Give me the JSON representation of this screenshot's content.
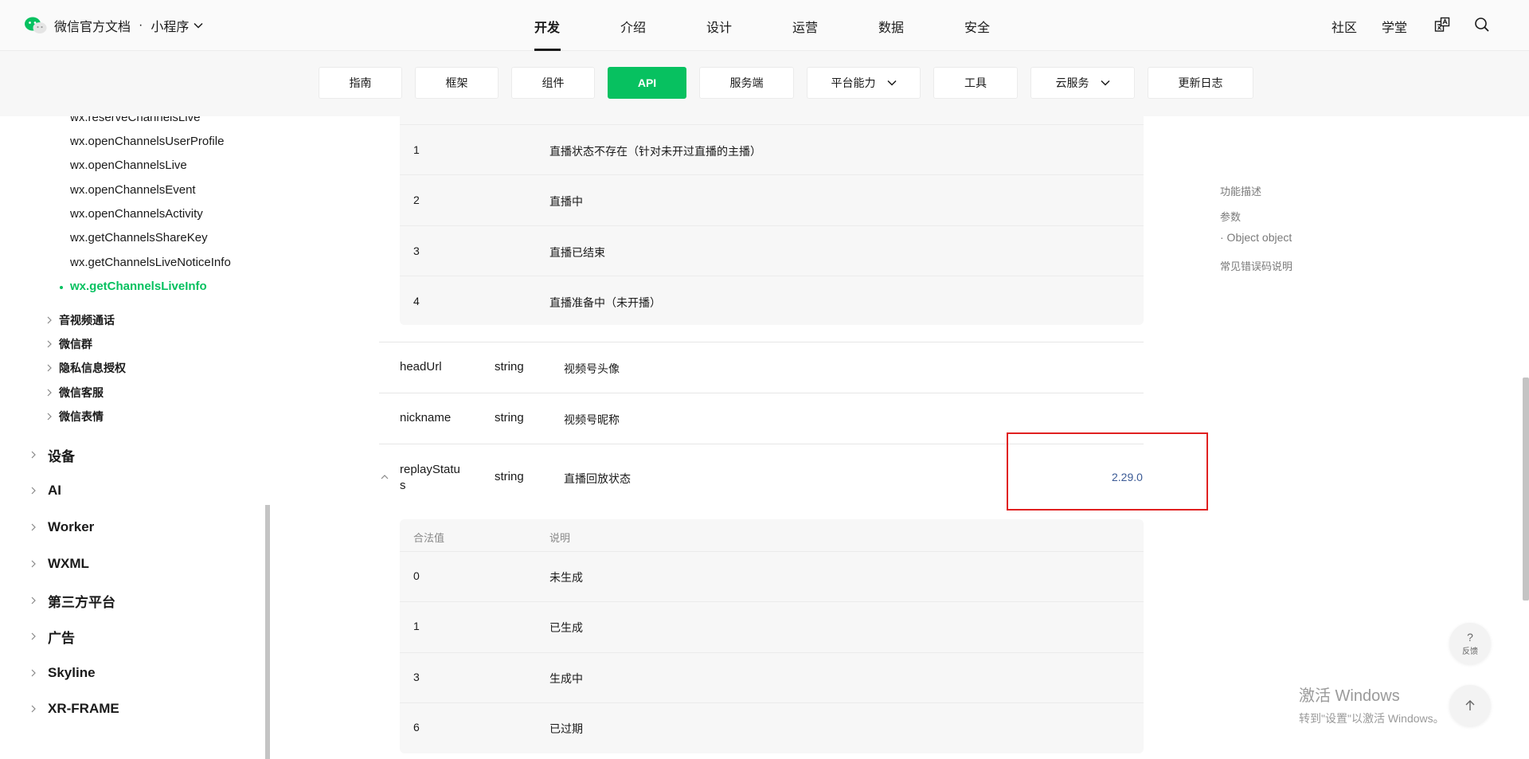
{
  "header": {
    "site_name": "微信官方文档",
    "separator": "·",
    "product": "小程序",
    "nav": [
      "开发",
      "介绍",
      "设计",
      "运营",
      "数据",
      "安全"
    ],
    "active_nav": "开发",
    "right_links": [
      "社区",
      "学堂"
    ],
    "icons": [
      "translate-icon",
      "search-icon"
    ]
  },
  "subnav": {
    "items": [
      {
        "label": "指南"
      },
      {
        "label": "框架"
      },
      {
        "label": "组件"
      },
      {
        "label": "API"
      },
      {
        "label": "服务端"
      },
      {
        "label": "平台能力"
      },
      {
        "label": "工具"
      },
      {
        "label": "云服务"
      },
      {
        "label": "更新日志"
      }
    ],
    "active": "API",
    "accent": "#07c160"
  },
  "sidebar": {
    "leaf_items": [
      "wx.reserveChannelsLive",
      "wx.openChannelsUserProfile",
      "wx.openChannelsLive",
      "wx.openChannelsEvent",
      "wx.openChannelsActivity",
      "wx.getChannelsShareKey",
      "wx.getChannelsLiveNoticeInfo",
      "wx.getChannelsLiveInfo"
    ],
    "active_leaf": "wx.getChannelsLiveInfo",
    "groups": [
      "音视频通话",
      "微信群",
      "隐私信息授权",
      "微信客服",
      "微信表情"
    ],
    "top_sections": [
      "设备",
      "AI",
      "Worker",
      "WXML",
      "第三方平台",
      "广告",
      "Skyline",
      "XR-FRAME"
    ]
  },
  "content": {
    "status_table": {
      "rows": [
        {
          "value": "1",
          "desc": "直播状态不存在（针对未开过直播的主播）"
        },
        {
          "value": "2",
          "desc": "直播中"
        },
        {
          "value": "3",
          "desc": "直播已结束"
        },
        {
          "value": "4",
          "desc": "直播准备中（未开播）"
        }
      ]
    },
    "properties": [
      {
        "name": "headUrl",
        "type": "string",
        "desc": "视频号头像",
        "version": ""
      },
      {
        "name": "nickname",
        "type": "string",
        "desc": "视频号昵称",
        "version": ""
      },
      {
        "name": "replayStatus",
        "type": "string",
        "desc": "直播回放状态",
        "version": "2.29.0"
      }
    ],
    "replay_table": {
      "header": {
        "value": "合法值",
        "desc": "说明"
      },
      "rows": [
        {
          "value": "0",
          "desc": "未生成"
        },
        {
          "value": "1",
          "desc": "已生成"
        },
        {
          "value": "3",
          "desc": "生成中"
        },
        {
          "value": "6",
          "desc": "已过期"
        }
      ]
    }
  },
  "toc": [
    "功能描述",
    "参数",
    "· Object object",
    "常见错误码说明"
  ],
  "feedback": {
    "symbol": "?",
    "label": "反馈"
  },
  "watermark": {
    "line1": "激活 Windows",
    "line2": "转到\"设置\"以激活 Windows。"
  }
}
